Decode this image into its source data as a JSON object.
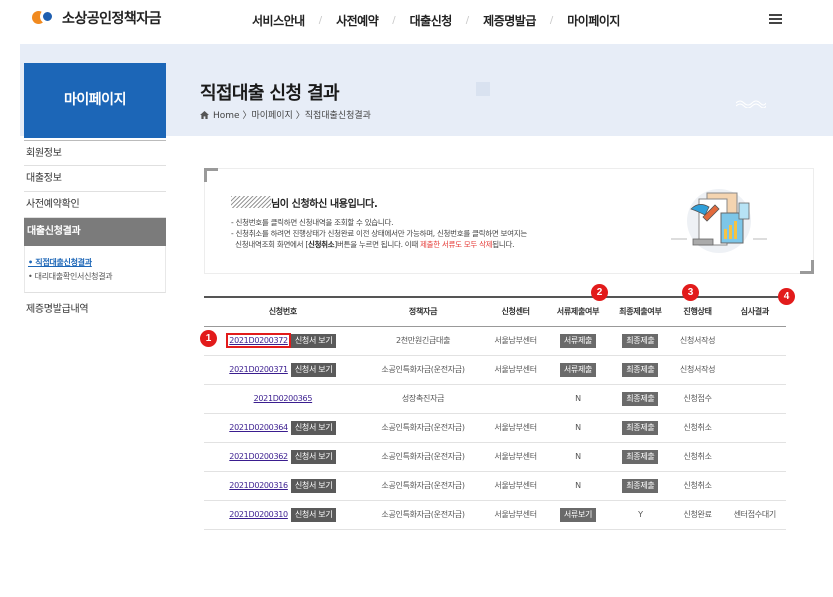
{
  "header": {
    "logo_text": "소상공인정책자금",
    "nav": [
      "서비스안내",
      "사전예약",
      "대출신청",
      "제증명발급",
      "마이페이지"
    ],
    "nav_separator": "/"
  },
  "banner": {
    "section_title": "마이페이지",
    "page_title": "직접대출 신청 결과",
    "breadcrumb": "Home 〉마이페이지 〉직접대출신청결과"
  },
  "sidebar": {
    "items": [
      "회원정보",
      "대출정보",
      "사전예약확인",
      "대출신청결과",
      "제증명발급내역"
    ],
    "sub_items": [
      "• 직접대출신청결과",
      "• 대리대출확인서신청결과"
    ]
  },
  "info": {
    "heading": "님이 신청하신 내용입니다.",
    "line1": "- 신청번호를 클릭하면 신청내역을 조회할 수 있습니다.",
    "line2": "- 신청취소를 하려면 진행상태가 신청완료 이전 상태에서만 가능하며, 신청번호를 클릭하면 보여지는",
    "line3_prefix": "신청내역조회 화면에서 [",
    "line3_bold": "신청취소",
    "line3_mid": "]버튼을 누르면 됩니다. 이때 ",
    "line3_red": "제출한 서류도 모두 삭제",
    "line3_suffix": "됩니다."
  },
  "table": {
    "headers": [
      "신청번호",
      "정책자금",
      "신청센터",
      "서류제출여부",
      "최종제출여부",
      "진행상태",
      "심사결과"
    ],
    "view_button_label": "신청서 보기",
    "rows": [
      {
        "id": "2021D0200372",
        "fund": "2천만원긴급대출",
        "center": "서울남부센터",
        "docs": "서류제출",
        "final": "최종제출",
        "status": "신청서작성",
        "result": ""
      },
      {
        "id": "2021D0200371",
        "fund": "소공인특화자금(운전자금)",
        "center": "서울남부센터",
        "docs": "서류제출",
        "final": "최종제출",
        "status": "신청서작성",
        "result": ""
      },
      {
        "id": "2021D0200365",
        "fund": "성장촉진자금",
        "center": "",
        "docs": "N",
        "final": "최종제출",
        "status": "신청접수",
        "result": ""
      },
      {
        "id": "2021D0200364",
        "fund": "소공인특화자금(운전자금)",
        "center": "서울남부센터",
        "docs": "N",
        "final": "최종제출",
        "status": "신청취소",
        "result": ""
      },
      {
        "id": "2021D0200362",
        "fund": "소공인특화자금(운전자금)",
        "center": "서울남부센터",
        "docs": "N",
        "final": "최종제출",
        "status": "신청취소",
        "result": ""
      },
      {
        "id": "2021D0200316",
        "fund": "소공인특화자금(운전자금)",
        "center": "서울남부센터",
        "docs": "N",
        "final": "최종제출",
        "status": "신청취소",
        "result": ""
      },
      {
        "id": "2021D0200310",
        "fund": "소공인특화자금(운전자금)",
        "center": "서울남부센터",
        "docs": "서류보기",
        "final": "Y",
        "status": "신청완료",
        "result": "센터접수대기"
      }
    ]
  },
  "markers": [
    "1",
    "2",
    "3",
    "4"
  ],
  "colors": {
    "brand_blue": "#1c66b7",
    "marker_red": "#e21b1b",
    "banner_bg": "#e7edf7"
  }
}
